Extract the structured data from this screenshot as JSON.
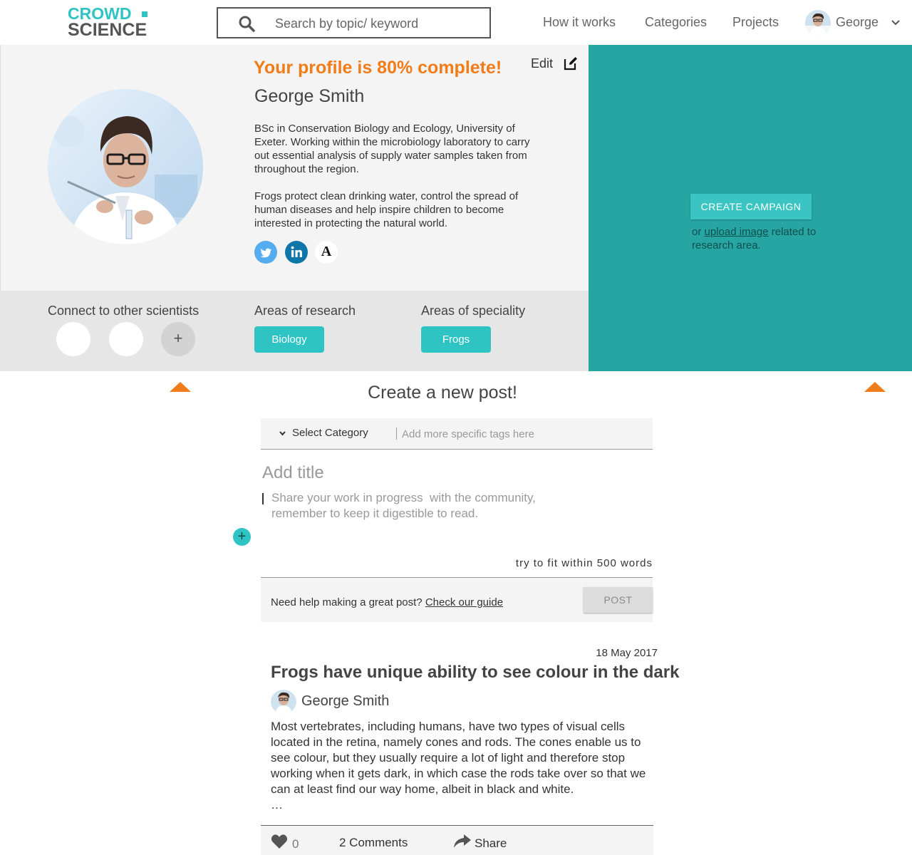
{
  "brand": {
    "line1": "CROWD",
    "line2": "SCIENCE",
    "accent": "#2fc4c4"
  },
  "search": {
    "placeholder": "Search by topic/ keyword",
    "value": ""
  },
  "nav": {
    "how_it_works": "How it works",
    "categories": "Categories",
    "projects": "Projects",
    "user": "George"
  },
  "profile": {
    "completion": "Your profile is 80% complete!",
    "edit_label": "Edit",
    "name": "George Smith",
    "bio_1": "BSc in Conservation Biology and Ecology, University of Exeter. Working within the microbiology laboratory to carry out essential analysis of supply water samples taken from throughout the region.",
    "bio_2": "Frogs protect clean drinking water, control the spread of human diseases and help inspire children to become interested in protecting the natural world.",
    "social": [
      "twitter-icon",
      "linkedin-icon",
      "academia-icon"
    ],
    "academia_glyph": "A"
  },
  "strip": {
    "connect_heading": "Connect to other scientists",
    "add_glyph": "+",
    "research_heading": "Areas of research",
    "research_tag": "Biology",
    "speciality_heading": "Areas of speciality",
    "speciality_tag": "Frogs"
  },
  "campaign": {
    "button": "CREATE CAMPAIGN",
    "or": "or",
    "link": "upload image",
    "rest": "related to research area."
  },
  "composer": {
    "heading": "Create a new post!",
    "category_label": "Select Category",
    "tags_placeholder": "Add more specific tags here",
    "title_placeholder": "Add title",
    "body_placeholder": "Share your work in progress  with the community, remember to keep it digestible to read.",
    "add_glyph": "+",
    "word_hint": "try to fit within 500 words",
    "help_text": "Need help making a great post?",
    "help_link": "Check our guide",
    "post_button": "POST"
  },
  "feed_post": {
    "date": "18 May 2017",
    "title": "Frogs have unique ability to see colour in the dark",
    "author": "George Smith",
    "body": "Most vertebrates, including humans, have two types of visual cells located in the retina, namely cones and rods. The cones enable us to see colour, but they usually require a lot of light and therefore stop working when it gets dark, in which case the rods take over so that we can at least find our way home, albeit in black and white.",
    "ellipsis": "…",
    "likes": "0",
    "comments": "2 Comments",
    "share": "Share"
  },
  "colors": {
    "orange": "#f07c1a",
    "teal_panel": "#26a5a3",
    "teal_button": "#2fc4c4",
    "profile_bg": "#f4f4f4",
    "strip_bg": "#e6e6e6"
  }
}
